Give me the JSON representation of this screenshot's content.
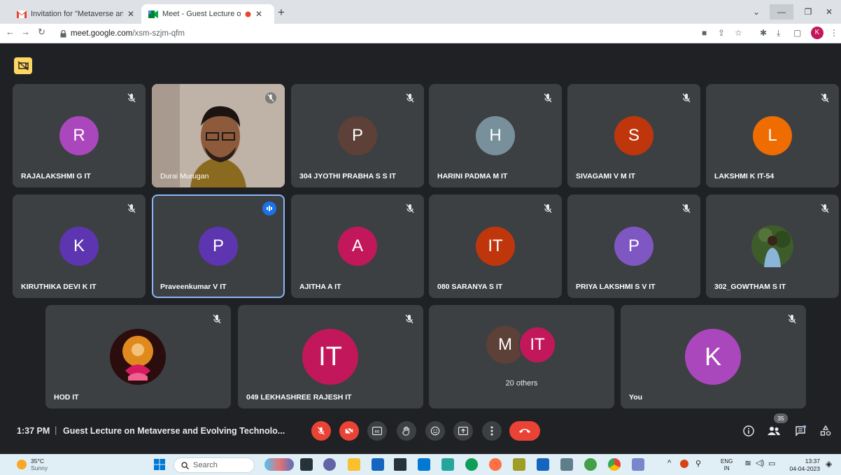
{
  "browser": {
    "tabs": [
      {
        "title": "Invitation for \"Metaverse and Evo",
        "active": false
      },
      {
        "title": "Meet - Guest Lecture on Met",
        "active": true
      }
    ],
    "url_host": "meet.google.com",
    "url_path": "/xsm-szjm-qfm",
    "profile_initial": "K"
  },
  "tiles": [
    {
      "name": "RAJALAKSHMI G IT",
      "initial": "R",
      "color": "#ab47bc"
    },
    {
      "name": "Durai Murugan",
      "initial": "",
      "color": "#8d6e63"
    },
    {
      "name": "304 JYOTHI PRABHA S S IT",
      "initial": "P",
      "color": "#5d4037"
    },
    {
      "name": "HARINI PADMA M IT",
      "initial": "H",
      "color": "#78909c"
    },
    {
      "name": "SIVAGAMI V M IT",
      "initial": "S",
      "color": "#bf360c"
    },
    {
      "name": "LAKSHMI K IT-54",
      "initial": "L",
      "color": "#ef6c00"
    },
    {
      "name": "KIRUTHIKA DEVI K IT",
      "initial": "K",
      "color": "#5e35b1"
    },
    {
      "name": "Praveenkumar V IT",
      "initial": "P",
      "color": "#5e35b1"
    },
    {
      "name": "AJITHA A IT",
      "initial": "A",
      "color": "#c2185b"
    },
    {
      "name": "080 SARANYA S IT",
      "initial": "IT",
      "color": "#bf360c"
    },
    {
      "name": "PRIYA LAKSHMI S V IT",
      "initial": "P",
      "color": "#7e57c2"
    },
    {
      "name": "302_GOWTHAM S IT",
      "initial": "",
      "color": "#33691e"
    },
    {
      "name": "HOD IT",
      "initial": "",
      "color": "#6d1b1b"
    },
    {
      "name": "049 LEKHASHREE RAJESH IT",
      "initial": "IT",
      "color": "#c2185b"
    },
    {
      "name": "20 others",
      "initial": "M",
      "initial2": "IT",
      "color": "#5d4037",
      "color2": "#c2185b"
    },
    {
      "name": "You",
      "initial": "K",
      "color": "#ab47bc"
    }
  ],
  "meeting": {
    "time": "1:37 PM",
    "separator": "|",
    "title": "Guest Lecture on Metaverse and Evolving Technolo...",
    "participant_count": "35"
  },
  "taskbar": {
    "temp": "35°C",
    "weather": "Sunny",
    "search": "Search",
    "lang1": "ENG",
    "lang2": "IN",
    "time": "13:37",
    "date": "04-04-2023"
  }
}
